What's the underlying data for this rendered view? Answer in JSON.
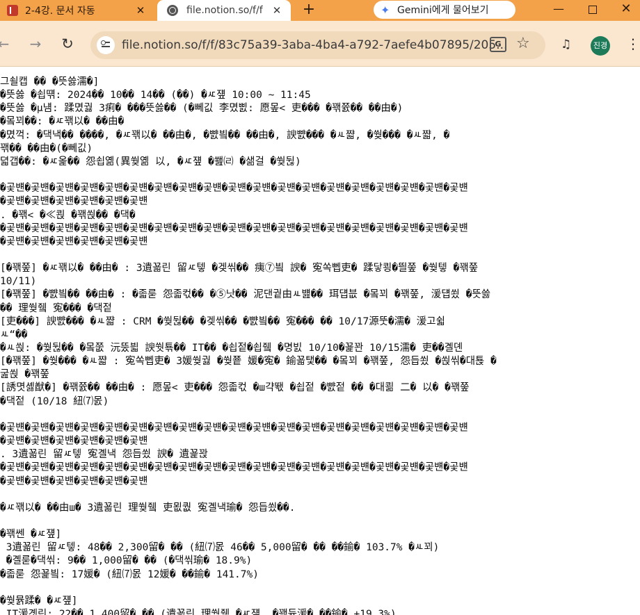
{
  "tabs": [
    {
      "title": "2-4강. 문서 자동",
      "close": "✕"
    },
    {
      "title": "file.notion.so/f/f",
      "close": "✕"
    }
  ],
  "new_tab": "+",
  "gemini": {
    "label": "Gemini에게 물어보기",
    "icon": "✦"
  },
  "window_controls": {
    "minimize": "—",
    "close": "✕"
  },
  "toolbar": {
    "back": "←",
    "forward": "→",
    "reload": "↻",
    "url": "file.notion.so/f/f/83c75a39-3aba-4ba4-a792-7aefe4b07895/205...",
    "translate": "G",
    "star": "☆",
    "media": "♫",
    "avatar": "진경",
    "menu": "⋮"
  },
  "document": {
    "lines": [
      "그쇨캡 �� �뜻쓿濡�]",
      "�뜻쓿 �쇱떆: 2024�� 10�� 14�� (��) �ㅼ쟾 10:00 ~ 11:45",
      "�뜻쓿 �μ냼: 蹂몄궗 3痢� ���뜻쓿�� (�뻬깂 李몄삜: 愿뫂< 吏��� �꽦쯄�� ��由�)",
      "�뫀꾀��: �ㅼ꽦以� ��由�",
      "�몄꺽: �댁낵�� ����, �ㅼ꽦以� ��由�, �뺤빀�� ��由�, 諛뺤��� �ㅻ쨟, �쒖��� �ㅻ쨟, �",
      "꽦�� ��由�(�뻬깂)",
      "뎗갭��: �ㅼ옱�� 怨쇱옒(異쒖옒 以, �ㅼ쟾 �쐞㈃ �샒걸 �쒖뒪)",
      "",
      "�곷뱬�곷뱬�곷뱬�곷뱬�곷뱬�곷뱬�곷뱬�곷뱬�곷뱬�곷뱬�곷뱬�곷뱬�곷뱬�곷뱬�곷뱬�곷뱬�곷뱬�곷뱬�곷뱬",
      "�곷뱬�곷뱬�곷뱬�곷뱬�곷뱬�곷뱬",
      ". �꽦< �≪쾭 �꽦쐱�� �댁�",
      "�곷뱬�곷뱬�곷뱬�곷뱬�곷뱬�곷뱬�곷뱬�곷뱬�곷뱬�곷뱬�곷뱬�곷뱬�곷뱬�곷뱬�곷뱬�곷뱬�곷뱬�곷뱬�곷뱬",
      "�곷뱬�곷뱬�곷뱬�곷뱬�곷뱬�곷뱬",
      "",
      "[�꽦쭢] �ㅼ꽦以� ��由� : 3遺꾧린 留ㅼ텧 �겢씪�� 痍⑦빀 諛� 寃쏙뻽吏� 蹂닿쾽�띌쭢 �쒖텧 �꽦쭢",
      "10/11)",
      "[�꽦쭢] �뺤빀�� ��由� : �졻룯 怨졻컧�� �⑤낫�� 泥댄궡由ㅻ뱶�� 珥덉븞 �뫀꾀 �꽦쭢, 湲덉쑀 �뜻쓿",
      "�� 理쒖쥌 寃��� �댁젙",
      "[吏���] 諛뺤��� �ㅻ쨟 : CRM �쒖뒪�� �겢씪�� �뺤빀�� 寃��� �� 10/17源뚯�濡� 湲고쉷",
      "ㅻ“��",
      "�ㅻ쐱: �쒖뒪�� �뫀쭚 沅뚰븳 諛쒓툒�� IT�� �쇱젙�쇱쥌 �명빐 10/10�꾩꽌 10/15濡� 吏��곌뎬",
      "[�꽦쭢] �쒖��� �ㅻ쨟 : 寃쏙뻽吏� 3媛쒖궗 �쒖쭅 媛�寃� 鍮꾧탳�� �뫀꾀 �꽦쭢, 怨듭쑀 �쐱씪�대툕 �",
      "굺쐱 �꽦쭢",
      "[誘몃셿猷�] �꽦쯄�� ��由� : 愿뫂< 吏��� 怨졻컧 �ш갹뙋 �쇱젙 �뺤젙 �� �대쾲 二� 以� �꽦쭢",
      "�댁젙 (10/18 紐⑺몴)",
      "",
      "�곷뱬�곷뱬�곷뱬�곷뱬�곷뱬�곷뱬�곷뱬�곷뱬�곷뱬�곷뱬�곷뱬�곷뱬�곷뱬�곷뱬�곷뱬�곷뱬�곷뱬�곷뱬�곷뱬",
      "�곷뱬�곷뱬�곷뱬�곷뱬�곷뱬�곷뱬",
      ". 3遺꾧린 留ㅼ텧 寃곌낵 怨듭쑀 諛� 遺꾩꽍",
      "�곷뱬�곷뱬�곷뱬�곷뱬�곷뱬�곷뱬�곷뱬�곷뱬�곷뱬�곷뱬�곷뱬�곷뱬�곷뱬�곷뱬�곷뱬�곷뱬�곷뱬�곷뱬�곷뱬",
      "�곷뱬�곷뱬�곷뱬�곷뱬�곷뱬�곷뱬",
      "",
      "�ㅼ꽦以� ��由ш� 3遺꾧린 理쒖쥌 吏묎퀎 寃곌낵瑜� 怨듭쑀��.",
      "",
      "�꽦쎈 �ㅼ쟾]",
      " 3遺꾧린 留ㅼ텧: 48�� 2,300留� �� (紐⑺몴 46�� 5,000留� �� ��鍮� 103.7% �ㅻ꾀)",
      " �곌룯�댁씪: 9�� 1,000留� �� (�댁씪瑜� 18.9%)",
      "�졻룯 怨꾩빀: 17媛� (紐⑺몴 12媛� ��鍮� 141.7%)",
      "",
      "�쒖뮭蹂� �ㅼ쟾]",
      " IT湲곗린: 22�� 1,400留� �� (遺꾧린 理쒖쥌 �ㅼ쟾, �꽦듃湲� ��鍮� +19.3%)"
    ]
  }
}
